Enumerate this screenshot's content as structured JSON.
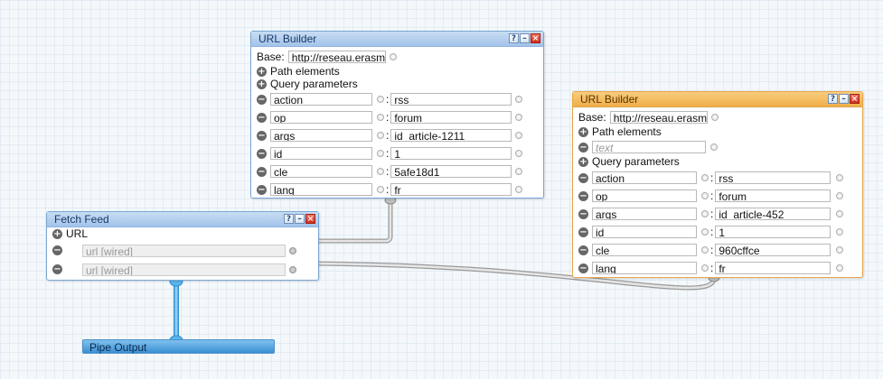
{
  "builder1": {
    "title": "URL Builder",
    "base_label": "Base:",
    "base_value": "http://reseau.erasm",
    "path_label": "Path elements",
    "query_label": "Query parameters",
    "params": [
      {
        "key": "action",
        "value": "rss"
      },
      {
        "key": "op",
        "value": "forum"
      },
      {
        "key": "args",
        "value": "id_article-1211"
      },
      {
        "key": "id",
        "value": "1"
      },
      {
        "key": "cle",
        "value": "5afe18d1"
      },
      {
        "key": "lang",
        "value": "fr"
      }
    ]
  },
  "builder2": {
    "title": "URL Builder",
    "base_label": "Base:",
    "base_value": "http://reseau.erasm",
    "path_label": "Path elements",
    "path_placeholder": "text",
    "query_label": "Query parameters",
    "params": [
      {
        "key": "action",
        "value": "rss"
      },
      {
        "key": "op",
        "value": "forum"
      },
      {
        "key": "args",
        "value": "id_article-452"
      },
      {
        "key": "id",
        "value": "1"
      },
      {
        "key": "cle",
        "value": "960cffce"
      },
      {
        "key": "lang",
        "value": "fr"
      }
    ]
  },
  "fetch": {
    "title": "Fetch Feed",
    "url_label": "URL",
    "urls": [
      "url [wired]",
      "url [wired]"
    ]
  },
  "output": {
    "title": "Pipe Output"
  },
  "window_buttons": {
    "help": "?",
    "minimize": "–",
    "close": "×"
  },
  "separator": ":",
  "icons": {
    "add": "+",
    "remove": "−"
  },
  "colors": {
    "blue_border": "#7aa6d4",
    "orange_border": "#e8a84a",
    "output_wire": "#4aa8e0",
    "wire": "#b8b8b8"
  }
}
